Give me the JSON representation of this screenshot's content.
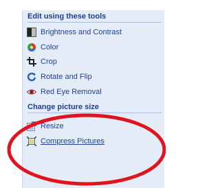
{
  "edit_section": {
    "title": "Edit using these tools",
    "items": [
      {
        "label": "Brightness and Contrast",
        "icon": "brightness-contrast-icon"
      },
      {
        "label": "Color",
        "icon": "color-wheel-icon"
      },
      {
        "label": "Crop",
        "icon": "crop-icon"
      },
      {
        "label": "Rotate and Flip",
        "icon": "rotate-flip-icon"
      },
      {
        "label": "Red Eye Removal",
        "icon": "red-eye-icon"
      }
    ]
  },
  "size_section": {
    "title": "Change picture size",
    "items": [
      {
        "label": "Resize",
        "icon": "resize-icon"
      },
      {
        "label": "Compress Pictures",
        "icon": "compress-pictures-icon"
      }
    ]
  },
  "annotation": {
    "shape": "ellipse",
    "color": "#e0141e"
  }
}
